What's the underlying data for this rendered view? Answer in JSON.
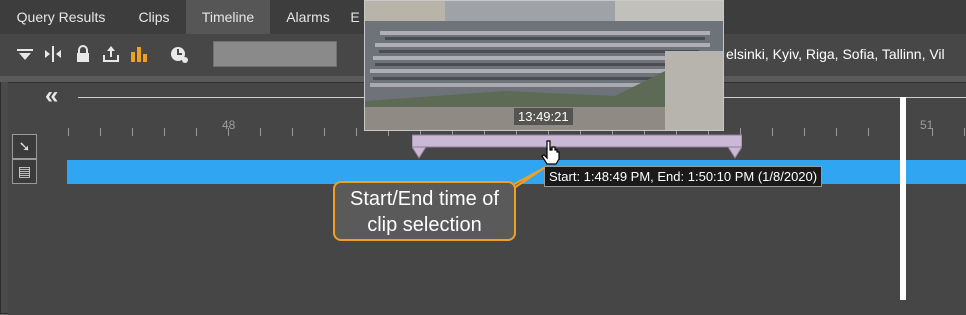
{
  "tabs": [
    {
      "label": "Query Results",
      "active": false
    },
    {
      "label": "Clips",
      "active": false
    },
    {
      "label": "Timeline",
      "active": true
    },
    {
      "label": "Alarms",
      "active": false
    },
    {
      "label": "E",
      "active": false
    }
  ],
  "toolbar": {
    "icons": [
      "filter-icon",
      "split-icon",
      "lock-icon",
      "export-icon",
      "chart-icon",
      "clock-settings-icon"
    ],
    "search_value": "",
    "timezone_text": "elsinki, Kyiv, Riga, Sofia, Tallinn, Vil"
  },
  "timeline": {
    "tick_labels": [
      "48",
      "51"
    ],
    "preview_time": "13:49:21",
    "tooltip": "Start: 1:48:49 PM, End: 1:50:10 PM (1/8/2020)",
    "colors": {
      "bar": "#30a6f3",
      "callout_border": "#f0a020",
      "cursor": "#ffffff"
    }
  },
  "callout": {
    "line1": "Start/End time of",
    "line2": "clip selection"
  }
}
